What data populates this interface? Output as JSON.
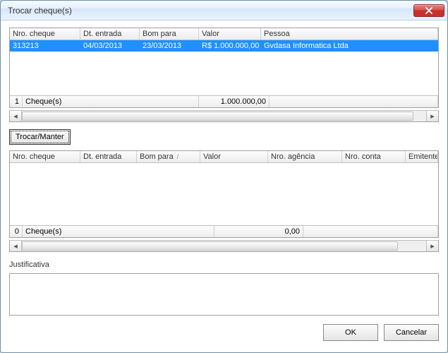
{
  "window": {
    "title": "Trocar cheque(s)"
  },
  "grid1": {
    "headers": {
      "nro": "Nro. cheque",
      "dt": "Dt. entrada",
      "bom": "Bom para",
      "valor": "Valor",
      "pessoa": "Pessoa"
    },
    "rows": [
      {
        "nro": "313213",
        "dt": "04/03/2013",
        "bom": "23/03/2013",
        "valor": "R$ 1.000.000,00",
        "pessoa": "Gvdasa Informatica Ltda"
      }
    ],
    "footer": {
      "count_prefix": "1",
      "count_label": "Cheque(s)",
      "total": "1.000.000,00"
    }
  },
  "actions": {
    "trocar_manter": "Trocar/Manter"
  },
  "grid2": {
    "headers": {
      "nro": "Nro. cheque",
      "dt": "Dt. entrada",
      "bom": "Bom para",
      "valor": "Valor",
      "ag": "Nro. agência",
      "conta": "Nro. conta",
      "emit": "Emitente"
    },
    "footer": {
      "count_prefix": "0",
      "count_label": "Cheque(s)",
      "total": "0,00"
    },
    "sort_mark": "/"
  },
  "justificativa": {
    "label": "Justificativa",
    "value": ""
  },
  "buttons": {
    "ok": "OK",
    "cancel": "Cancelar"
  }
}
